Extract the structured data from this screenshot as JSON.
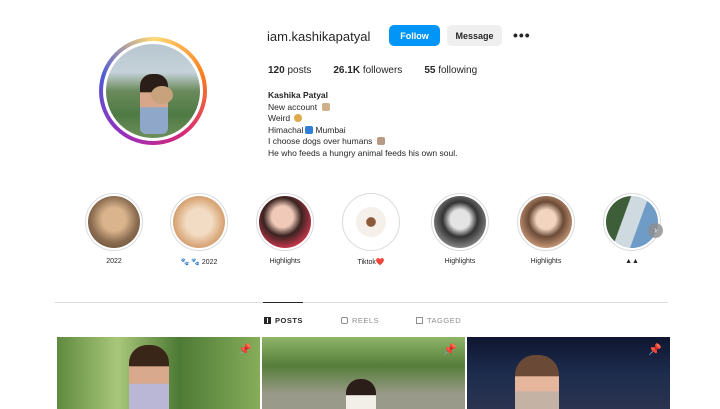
{
  "profile": {
    "username": "iam.kashikapatyal",
    "follow_label": "Follow",
    "message_label": "Message",
    "more_label": "•••",
    "stats": {
      "posts_count": "120",
      "posts_label": "posts",
      "followers_count": "26.1K",
      "followers_label": "followers",
      "following_count": "55",
      "following_label": "following"
    },
    "bio": {
      "name": "Kashika Patyal",
      "line1": "New account",
      "line2": "Weird",
      "line3_a": "Himachal",
      "line3_b": "Mumbai",
      "line4": "I choose dogs over humans",
      "line5": "He who feeds a hungry animal feeds his own soul."
    }
  },
  "highlights": [
    {
      "label": "2022",
      "color": "#b58a5e"
    },
    {
      "label": "🐾 🐾 2022",
      "color": "#e8c6a6"
    },
    {
      "label": "Highlights",
      "color": "#c84a5a"
    },
    {
      "label": "Tiktok❤️",
      "color": "#f2f2f2"
    },
    {
      "label": "Highlights",
      "color": "#777777"
    },
    {
      "label": "Highlights",
      "color": "#caa58a"
    },
    {
      "label": "▲▲",
      "color": "#7fa3c4"
    }
  ],
  "tabs": [
    {
      "label": "POSTS",
      "icon": "grid-icon"
    },
    {
      "label": "REELS",
      "icon": "reels-icon"
    },
    {
      "label": "TAGGED",
      "icon": "tag-icon"
    }
  ],
  "posts": [
    {
      "pinned": "📌"
    },
    {
      "pinned": "📌"
    },
    {
      "pinned": "📌"
    }
  ],
  "colors": {
    "accent": "#0095f6",
    "secondary_button": "#efefef",
    "divider": "#dbdbdb"
  }
}
